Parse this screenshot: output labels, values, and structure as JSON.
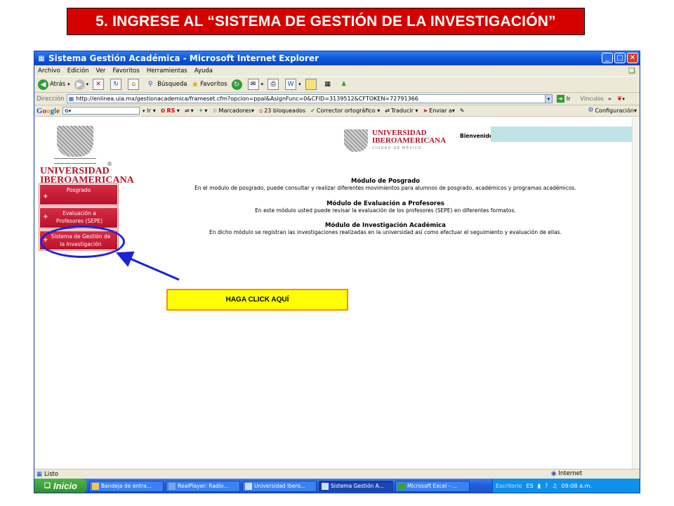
{
  "slide": {
    "title": "5. INGRESE AL “SISTEMA DE GESTIÓN DE LA INVESTIGACIÓN”"
  },
  "window": {
    "title": "Sistema Gestión Académica - Microsoft Internet Explorer",
    "btn_min": "_",
    "btn_max": "□",
    "btn_close": "✕"
  },
  "menu": [
    "Archivo",
    "Edición",
    "Ver",
    "Favoritos",
    "Herramientas",
    "Ayuda"
  ],
  "toolbar": {
    "back": "Atrás",
    "search": "Búsqueda",
    "favorites": "Favoritos"
  },
  "address": {
    "label": "Dirección",
    "url": "http://enlinea.uia.mx/gestionacademica/frameset.cfm?opcion=ppal&AsignFunc=0&CFID=3139512&CFTOKEN=72791366",
    "go": "Ir",
    "links": "Vínculos"
  },
  "google": {
    "logo": [
      "G",
      "o",
      "o",
      "g",
      "l",
      "e"
    ],
    "go": "Ir",
    "rs": "RS",
    "bookmarks": "Marcadores▾",
    "blocked": "23 bloqueados",
    "spell": "Corrector ortográfico",
    "translate": "Traducir",
    "send": "Enviar a▾",
    "config": "Configuración▾"
  },
  "page": {
    "uni_line1": "UNIVERSIDAD",
    "uni_line2": "IBEROAMERICANA",
    "uni_city": "CIUDAD DE MÉXICO",
    "reg": "®",
    "welcome": "Bienvenido:",
    "sidebar": [
      {
        "label": "Posgrado",
        "plus": "+"
      },
      {
        "label": "Evaluación a Profesores (SEPE)",
        "plus": "+"
      },
      {
        "label": "Sistema de Gestión de la Investigación",
        "plus": "+"
      }
    ],
    "modules": [
      {
        "title": "Módulo de Posgrado",
        "desc": "En el modulo de posgrado, puede consultar y realizar diferentes movimientos para alumnos de posgrado, académicos y programas académicos."
      },
      {
        "title": "Módulo de Evaluación a Profesores",
        "desc": "En este módulo usted puede revisar la evaluación de los profesores (SEPE) en diferentes formatos."
      },
      {
        "title": "Módulo de Investigación Académica",
        "desc": "En dicho módulo se registran las investigaciones realizadas en la universidad así como efectuar el seguimiento y evaluación de ellas."
      }
    ]
  },
  "status": {
    "left": "Listo",
    "zone": "Internet"
  },
  "taskbar": {
    "start": "Inicio",
    "tasks": [
      "Bandeja de entra...",
      "RealPlayer: Radio...",
      "Universidad Ibero...",
      "Sistema Gestión A...",
      "Microsoft Excel - ..."
    ],
    "active_task": 3,
    "tray_desk": "Escritorio",
    "tray_lang": "ES",
    "clock": "09:08 a.m."
  },
  "callout": {
    "text": "HAGA CLICK AQUÍ"
  },
  "colors": {
    "accent_red": "#d40000",
    "ie_blue": "#0a52d6",
    "uni_red": "#b1142a",
    "circle_blue": "#1c22d6",
    "callout_yellow": "#ffff00",
    "callout_border": "#ff8c00"
  }
}
